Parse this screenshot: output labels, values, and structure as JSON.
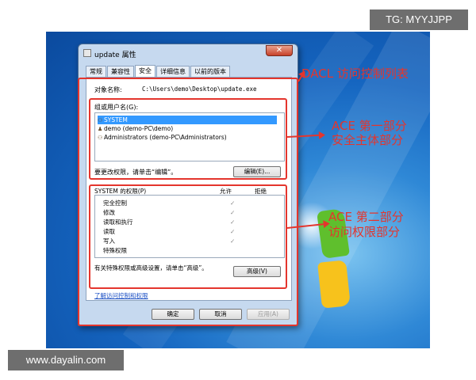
{
  "watermarks": {
    "top_right": "TG: MYYJJPP",
    "bottom_left": "www.dayalin.com"
  },
  "window": {
    "title": "update 属性",
    "close_label": "✕",
    "tabs": [
      {
        "label": "常规"
      },
      {
        "label": "兼容性"
      },
      {
        "label": "安全",
        "active": true
      },
      {
        "label": "详细信息"
      },
      {
        "label": "以前的版本"
      }
    ],
    "object_name_label": "对象名称:",
    "object_name_value": "C:\\Users\\demo\\Desktop\\update.exe",
    "group_label": "组或用户名(G):",
    "users": [
      {
        "name": "SYSTEM",
        "icon": "group-icon",
        "selected": true
      },
      {
        "name": "demo (demo-PC\\demo)",
        "icon": "user-icon",
        "selected": false
      },
      {
        "name": "Administrators (demo-PC\\Administrators)",
        "icon": "group-icon",
        "selected": false
      }
    ],
    "edit_hint": "要更改权限，请单击“编辑”。",
    "edit_button": "编辑(E)...",
    "perm_header": "SYSTEM 的权限(P)",
    "allow_header": "允许",
    "deny_header": "拒绝",
    "permissions": [
      {
        "name": "完全控制",
        "allow": "✓"
      },
      {
        "name": "修改",
        "allow": "✓"
      },
      {
        "name": "读取和执行",
        "allow": "✓"
      },
      {
        "name": "读取",
        "allow": "✓"
      },
      {
        "name": "写入",
        "allow": "✓"
      },
      {
        "name": "特殊权限",
        "allow": ""
      }
    ],
    "advanced_hint": "有关特殊权限或高级设置，请单击“高级”。",
    "advanced_button": "高级(V)",
    "learn_link": "了解访问控制和权限",
    "ok_button": "确定",
    "cancel_button": "取消",
    "apply_button": "应用(A)"
  },
  "annotations": {
    "dacl": "DACL 访问控制列表",
    "ace1_line1": "ACE 第一部分",
    "ace1_line2": "安全主体部分",
    "ace2_line1": "ACE 第二部分",
    "ace2_line2": "访问权限部分",
    "color": "#e4352d"
  }
}
